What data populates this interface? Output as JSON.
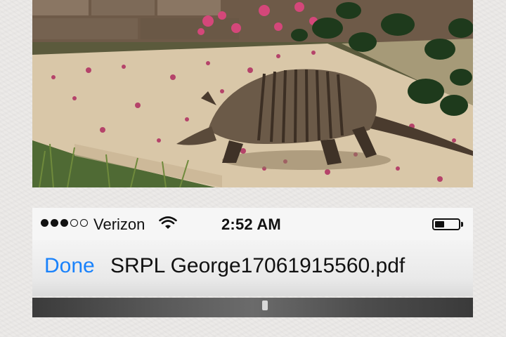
{
  "status_bar": {
    "signal_bars_filled": 3,
    "signal_bars_total": 5,
    "carrier": "Verizon",
    "wifi_icon": "wifi-icon",
    "time": "2:52 AM",
    "battery_level": 0.4
  },
  "nav_bar": {
    "done_label": "Done",
    "title": "SRPL George17061915560.pdf"
  },
  "photo": {
    "subject_icon": "armadillo-photo"
  },
  "colors": {
    "accent": "#1a82fb",
    "status_bg": "#f6f6f6",
    "page_bg": "#ecebe9"
  }
}
